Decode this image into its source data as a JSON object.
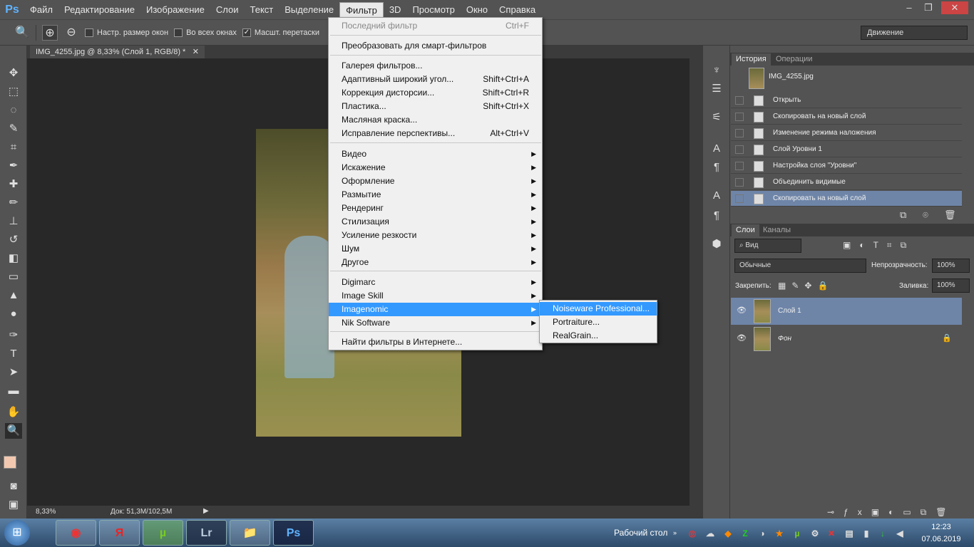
{
  "menubar": {
    "logo": "Ps",
    "items": [
      "Файл",
      "Редактирование",
      "Изображение",
      "Слои",
      "Текст",
      "Выделение",
      "Фильтр",
      "3D",
      "Просмотр",
      "Окно",
      "Справка"
    ],
    "active": "Фильтр",
    "window_buttons": [
      "–",
      "❐",
      "✕"
    ]
  },
  "options": {
    "zoom_icon": "🔍",
    "zoom_in": "⊕",
    "zoom_out": "⊖",
    "resize_windows": "Настр. размер окон",
    "all_windows": "Во всех окнах",
    "scrubby": "Масшт. перетаски",
    "scrubby_checked": "✓",
    "workspace": "Движение"
  },
  "document": {
    "tab_title": "IMG_4255.jpg @ 8,33% (Слой 1, RGB/8) *",
    "tab_close": "✕",
    "zoom": "8,33%",
    "doc_size": "Док: 51,3M/102,5M",
    "status_arrow": "▶"
  },
  "filter_menu": {
    "last_filter": "Последний фильтр",
    "last_filter_sc": "Ctrl+F",
    "smart": "Преобразовать для смарт-фильтров",
    "gallery": "Галерея фильтров...",
    "adaptive": "Адаптивный широкий угол...",
    "adaptive_sc": "Shift+Ctrl+A",
    "lens": "Коррекция дисторсии...",
    "lens_sc": "Shift+Ctrl+R",
    "liquify": "Пластика...",
    "liquify_sc": "Shift+Ctrl+X",
    "oil": "Масляная краска...",
    "vanishing": "Исправление перспективы...",
    "vanishing_sc": "Alt+Ctrl+V",
    "sub": [
      "Видео",
      "Искажение",
      "Оформление",
      "Размытие",
      "Рендеринг",
      "Стилизация",
      "Усиление резкости",
      "Шум",
      "Другое"
    ],
    "plugins": [
      "Digimarc",
      "Image Skill",
      "Imagenomic",
      "Nik Software"
    ],
    "browse": "Найти фильтры в Интернете...",
    "arrow": "▶"
  },
  "submenu": {
    "items": [
      "Noiseware Professional...",
      "Portraiture...",
      "RealGrain..."
    ]
  },
  "history": {
    "tabs": [
      "История",
      "Операции"
    ],
    "snapshot": "IMG_4255.jpg",
    "steps": [
      "Открыть",
      "Скопировать на новый слой",
      "Изменение режима наложения",
      "Слой Уровни 1",
      "Настройка слоя \"Уровни\"",
      "Объединить видимые",
      "Скопировать на новый слой"
    ]
  },
  "layers": {
    "tabs": [
      "Слои",
      "Каналы"
    ],
    "filter_kind": "Вид",
    "blend_mode": "Обычные",
    "opacity_label": "Непрозрачность:",
    "opacity": "100%",
    "lock_label": "Закрепить:",
    "fill_label": "Заливка:",
    "fill": "100%",
    "items": [
      "Слой 1",
      "Фон"
    ],
    "eye": "👁",
    "lock": "🔒"
  },
  "taskbar": {
    "start": "⊞",
    "desktop": "Рабочий стол",
    "time": "12:23",
    "date": "07.06.2019",
    "apps": [
      "Chrome",
      "Я",
      "µ",
      "Lr",
      "📁",
      "Ps"
    ]
  }
}
